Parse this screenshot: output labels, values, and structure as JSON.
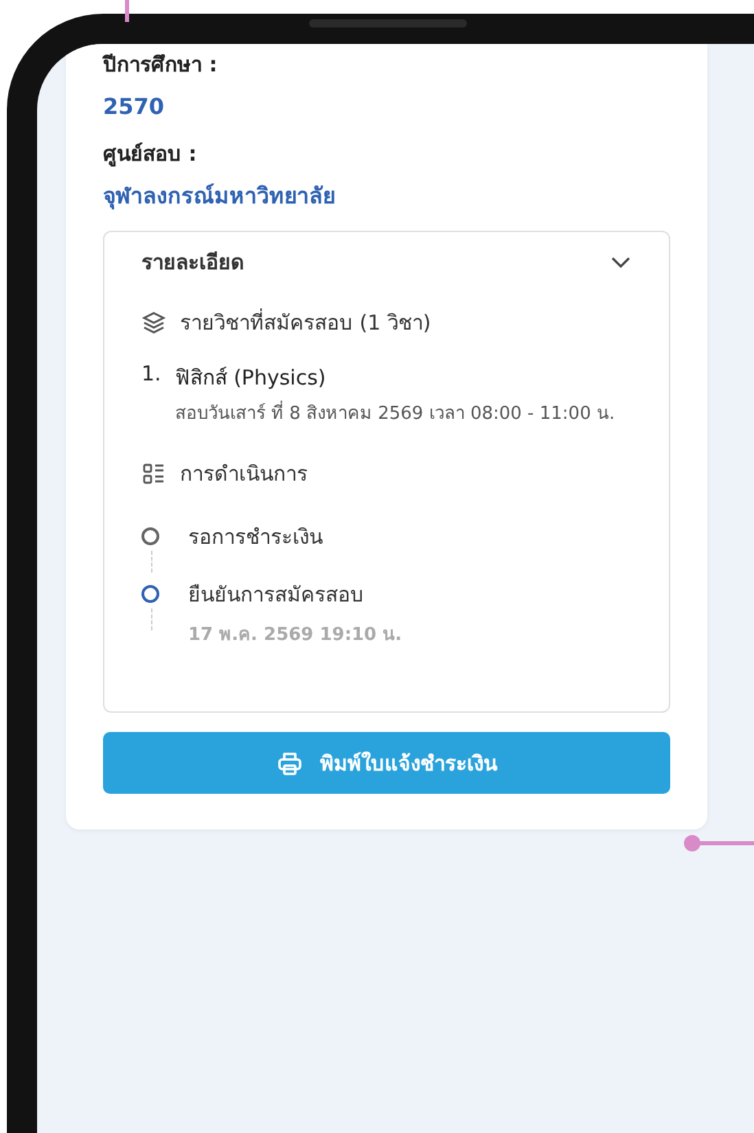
{
  "fields": [
    {
      "label": "ปีการศึกษา :",
      "value": "2570"
    },
    {
      "label": "ศูนย์สอบ :",
      "value": "จุฬาลงกรณ์มหาวิทยาลัย"
    }
  ],
  "details": {
    "title": "รายละเอียด",
    "expanded": true,
    "subjects_heading": "รายวิชาที่สมัครสอบ (1 วิชา)",
    "subjects": [
      {
        "number": "1.",
        "name": "ฟิสิกส์ (Physics)",
        "schedule": "สอบวันเสาร์ ที่  8 สิงหาคม 2569  เวลา 08:00 - 11:00 น."
      }
    ],
    "progress_heading": "การดำเนินการ",
    "steps": [
      {
        "label": "รอการชำระเงิน",
        "active": false
      },
      {
        "label": "ยืนยันการสมัครสอบ",
        "active": true,
        "time": "17 พ.ค. 2569 19:10 น."
      }
    ]
  },
  "print_button": "พิมพ์ใบแจ้งชำระเงิน"
}
